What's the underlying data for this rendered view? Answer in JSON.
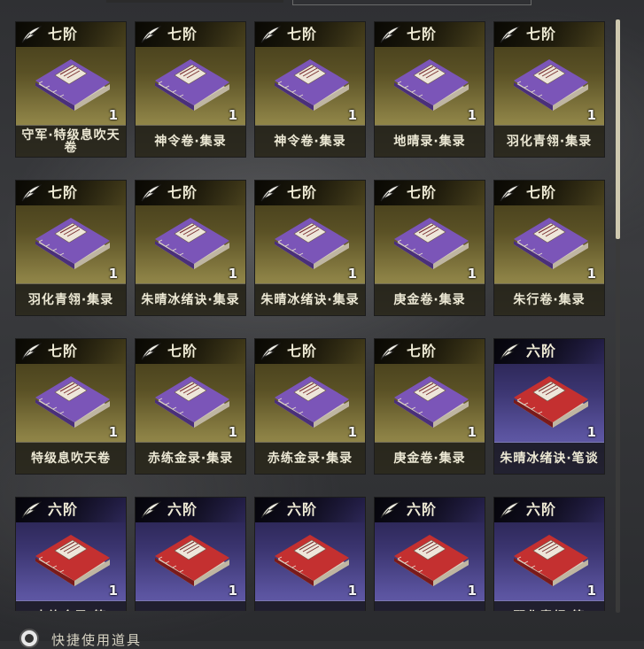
{
  "inventory": {
    "items": [
      {
        "tier": "七阶",
        "name": "守军·特级息吹天卷",
        "count": "1",
        "grade": "t7"
      },
      {
        "tier": "七阶",
        "name": "神令卷·集录",
        "count": "1",
        "grade": "t7"
      },
      {
        "tier": "七阶",
        "name": "神令卷·集录",
        "count": "1",
        "grade": "t7"
      },
      {
        "tier": "七阶",
        "name": "地晴录·集录",
        "count": "1",
        "grade": "t7"
      },
      {
        "tier": "七阶",
        "name": "羽化青翎·集录",
        "count": "1",
        "grade": "t7"
      },
      {
        "tier": "七阶",
        "name": "羽化青翎·集录",
        "count": "1",
        "grade": "t7"
      },
      {
        "tier": "七阶",
        "name": "朱晴冰绪诀·集录",
        "count": "1",
        "grade": "t7"
      },
      {
        "tier": "七阶",
        "name": "朱晴冰绪诀·集录",
        "count": "1",
        "grade": "t7"
      },
      {
        "tier": "七阶",
        "name": "庚金卷·集录",
        "count": "1",
        "grade": "t7"
      },
      {
        "tier": "七阶",
        "name": "朱行卷·集录",
        "count": "1",
        "grade": "t7"
      },
      {
        "tier": "七阶",
        "name": "特级息吹天卷",
        "count": "1",
        "grade": "t7"
      },
      {
        "tier": "七阶",
        "name": "赤练金录·集录",
        "count": "1",
        "grade": "t7"
      },
      {
        "tier": "七阶",
        "name": "赤练金录·集录",
        "count": "1",
        "grade": "t7"
      },
      {
        "tier": "七阶",
        "name": "庚金卷·集录",
        "count": "1",
        "grade": "t7"
      },
      {
        "tier": "六阶",
        "name": "朱晴冰绪诀·笔谈",
        "count": "1",
        "grade": "t6"
      },
      {
        "tier": "六阶",
        "name": "赤练金录·笔",
        "count": "1",
        "grade": "t6"
      },
      {
        "tier": "六阶",
        "name": "",
        "count": "1",
        "grade": "t6"
      },
      {
        "tier": "六阶",
        "name": "",
        "count": "1",
        "grade": "t6"
      },
      {
        "tier": "六阶",
        "name": "",
        "count": "1",
        "grade": "t6"
      },
      {
        "tier": "六阶",
        "name": "羽化青翎·笔",
        "count": "1",
        "grade": "t6"
      }
    ]
  },
  "footer": {
    "label": "快捷使用道具"
  },
  "colors": {
    "t7_cover": "#7b55b8",
    "t6_cover": "#c43030",
    "t7_bg": "#5a5125",
    "t6_bg": "#3b3570"
  }
}
